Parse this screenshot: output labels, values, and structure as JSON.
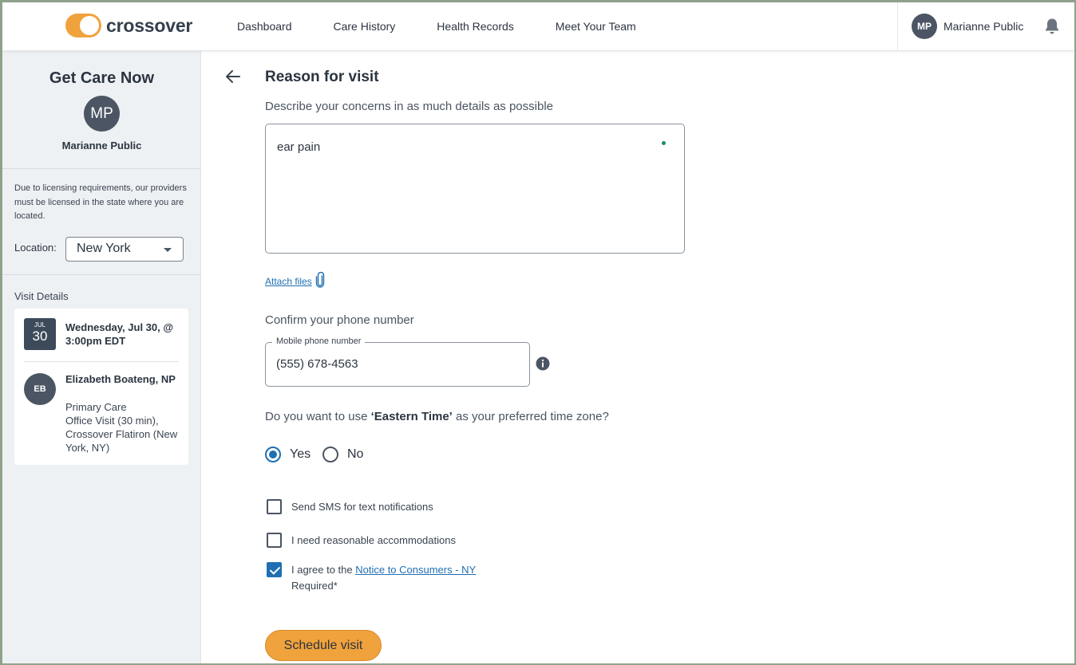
{
  "header": {
    "logo_text": "crossover",
    "nav": [
      "Dashboard",
      "Care History",
      "Health Records",
      "Meet Your Team"
    ],
    "user_initials": "MP",
    "user_name": "Marianne Public",
    "icons": {
      "bell": "bell-icon"
    }
  },
  "sidebar": {
    "title": "Get Care Now",
    "avatar_initials": "MP",
    "patient_name": "Marianne Public",
    "licensing_note": "Due to licensing requirements, our providers must be licensed in the state where you are located.",
    "location_label": "Location:",
    "location_value": "New York",
    "visit_details_label": "Visit Details",
    "visit": {
      "month": "JUL",
      "day": "30",
      "datetime": "Wednesday, Jul 30, @ 3:00pm EDT",
      "provider_initials": "EB",
      "provider_name": "Elizabeth Boateng, NP",
      "visit_type": "Primary Care",
      "visit_mode": "Office Visit (30 min),",
      "location": "Crossover Flatiron (New York, NY)"
    }
  },
  "main": {
    "title": "Reason for visit",
    "subtitle": "Describe your concerns in as much details as possible",
    "reason_text": "ear pain",
    "attach_label": "Attach files",
    "phone_prompt": "Confirm your phone number",
    "phone_legend": "Mobile phone number",
    "phone_value": "(555) 678-4563",
    "tz_question_pre": "Do you want to use ",
    "tz_name": "‘Eastern Time’",
    "tz_question_post": " as your preferred time zone?",
    "tz_options": [
      {
        "label": "Yes",
        "selected": true
      },
      {
        "label": "No",
        "selected": false
      }
    ],
    "checks": {
      "sms": {
        "label": "Send SMS for text notifications",
        "checked": false
      },
      "accommodations": {
        "label": "I need reasonable accommodations",
        "checked": false
      },
      "agree": {
        "label_pre": "I agree to the ",
        "link": "Notice to Consumers - NY",
        "checked": true
      }
    },
    "required_note": "Required*",
    "schedule_button": "Schedule visit"
  },
  "colors": {
    "accent": "#f0a23c",
    "link": "#1f6fb2",
    "avatar": "#4b5563"
  }
}
